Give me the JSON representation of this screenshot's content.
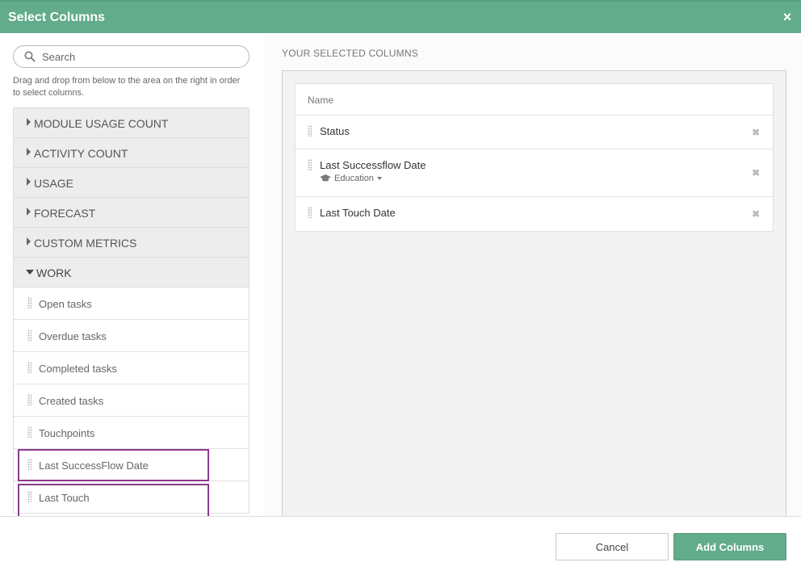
{
  "header": {
    "title": "Select Columns",
    "close_icon": "×"
  },
  "search": {
    "placeholder": "Search",
    "value": ""
  },
  "help_text": "Drag and drop from below to the area on the right in order to select columns.",
  "groups": [
    {
      "label": "MODULE USAGE COUNT",
      "expanded": false
    },
    {
      "label": "ACTIVITY COUNT",
      "expanded": false
    },
    {
      "label": "USAGE",
      "expanded": false
    },
    {
      "label": "FORECAST",
      "expanded": false
    },
    {
      "label": "CUSTOM METRICS",
      "expanded": false
    },
    {
      "label": "WORK",
      "expanded": true
    }
  ],
  "work_items": [
    {
      "label": "Open tasks",
      "highlighted": false
    },
    {
      "label": "Overdue tasks",
      "highlighted": false
    },
    {
      "label": "Completed tasks",
      "highlighted": false
    },
    {
      "label": "Created tasks",
      "highlighted": false
    },
    {
      "label": "Touchpoints",
      "highlighted": false
    },
    {
      "label": "Last SuccessFlow Date",
      "highlighted": true
    },
    {
      "label": "Last Touch",
      "highlighted": true
    }
  ],
  "selected": {
    "title": "YOUR SELECTED COLUMNS",
    "header": "Name",
    "rows": [
      {
        "label": "Status",
        "sub": ""
      },
      {
        "label": "Last Successflow Date",
        "sub": "Education"
      },
      {
        "label": "Last Touch Date",
        "sub": ""
      }
    ],
    "remove_icon": "✖"
  },
  "footer": {
    "cancel_label": "Cancel",
    "add_label": "Add Columns"
  },
  "colors": {
    "accent": "#62ab8b",
    "highlight": "#8b3b8f"
  }
}
